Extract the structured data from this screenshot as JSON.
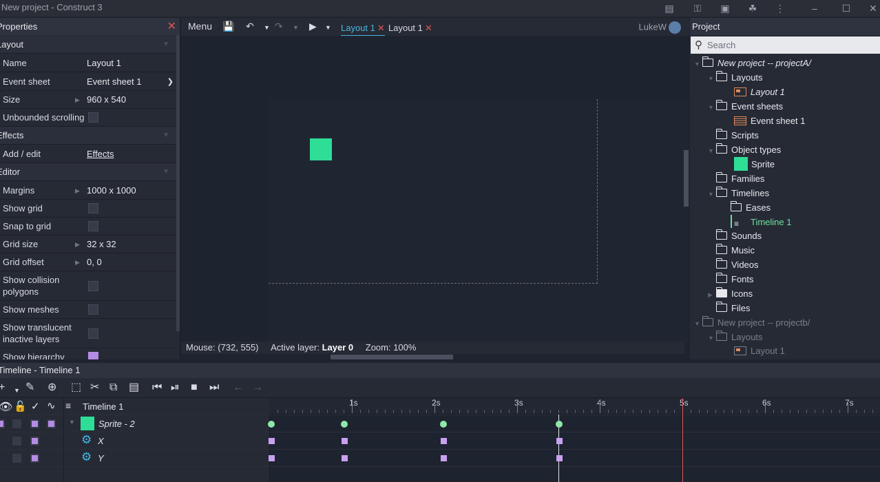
{
  "window": {
    "title": "New project - Construct 3"
  },
  "properties": {
    "header": "Properties",
    "sections": {
      "layout": "Layout",
      "effects": "Effects",
      "editor": "Editor"
    },
    "rows": {
      "name": {
        "label": "Name",
        "value": "Layout 1"
      },
      "event_sheet": {
        "label": "Event sheet",
        "value": "Event sheet 1"
      },
      "size": {
        "label": "Size",
        "value": "960 x 540"
      },
      "unbounded": {
        "label": "Unbounded scrolling"
      },
      "add_edit": {
        "label": "Add / edit",
        "value": "Effects"
      },
      "margins": {
        "label": "Margins",
        "value": "1000 x 1000"
      },
      "show_grid": {
        "label": "Show grid"
      },
      "snap_grid": {
        "label": "Snap to grid"
      },
      "grid_size": {
        "label": "Grid size",
        "value": "32 x 32"
      },
      "grid_offset": {
        "label": "Grid offset",
        "value": "0, 0"
      },
      "collision": {
        "label": "Show collision polygons"
      },
      "meshes": {
        "label": "Show meshes"
      },
      "translucent": {
        "label": "Show translucent inactive layers"
      },
      "hierarchy": {
        "label": "Show hierarchy"
      }
    }
  },
  "toolbar": {
    "menu": "Menu",
    "tabs": [
      {
        "label": "Layout 1",
        "active": true
      },
      {
        "label": "Layout 1",
        "active": false
      }
    ],
    "user": "LukeW"
  },
  "status": {
    "mouse": "Mouse: (732, 555)",
    "active_layer_label": "Active layer:",
    "active_layer": "Layer 0",
    "zoom": "Zoom: 100%"
  },
  "project": {
    "header": "Project",
    "search_placeholder": "Search",
    "tree": {
      "root_a": "New project -- projectA/",
      "layouts": "Layouts",
      "layout1": "Layout 1",
      "event_sheets": "Event sheets",
      "event_sheet1": "Event sheet 1",
      "scripts": "Scripts",
      "object_types": "Object types",
      "sprite": "Sprite",
      "families": "Families",
      "timelines": "Timelines",
      "eases": "Eases",
      "timeline1": "Timeline 1",
      "sounds": "Sounds",
      "music": "Music",
      "videos": "Videos",
      "fonts": "Fonts",
      "icons": "Icons",
      "files": "Files",
      "root_b": "New project -- projectb/",
      "layouts_b": "Layouts",
      "layout1_b": "Layout 1"
    }
  },
  "timeline": {
    "header": "Timeline - Timeline 1",
    "name": "Timeline 1",
    "track": "Sprite - 2",
    "prop_x": "X",
    "prop_y": "Y",
    "ruler": [
      "1s",
      "2s",
      "3s",
      "4s",
      "5s",
      "6s",
      "7s"
    ]
  },
  "colors": {
    "sprite": "#2ede97",
    "accent": "#48b6e0",
    "keyframe_prop": "#c9a0f0",
    "playhead": "#e05555"
  }
}
